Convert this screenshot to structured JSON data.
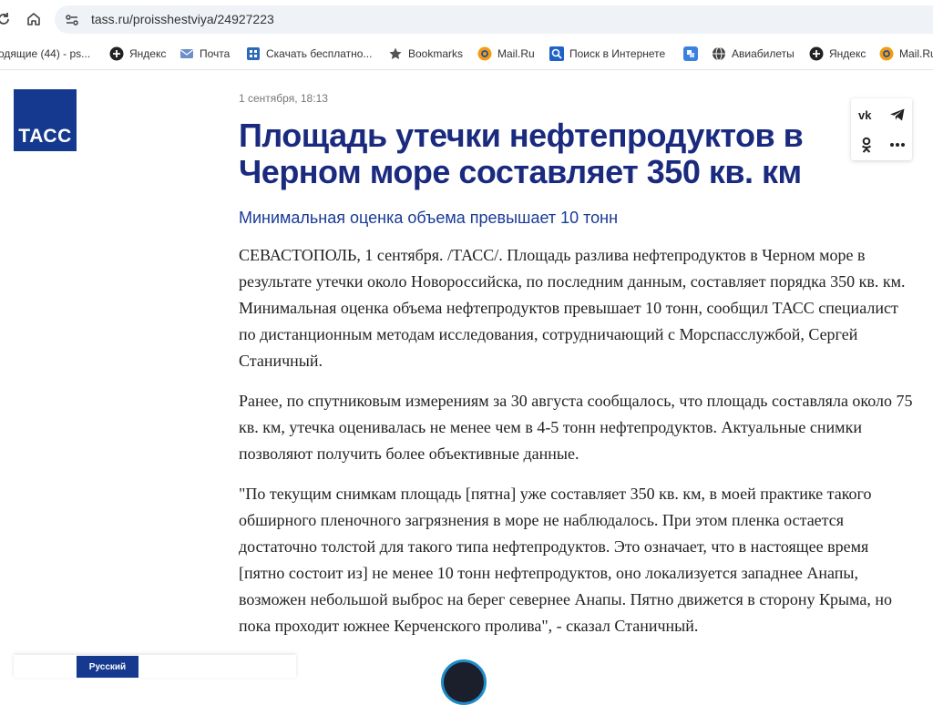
{
  "browser": {
    "url": "tass.ru/proisshestviya/24927223",
    "bookmarks": [
      {
        "label": "одящие (44) - ps...",
        "icon": "none"
      },
      {
        "label": "Яндекс",
        "icon": "yandex-icon"
      },
      {
        "label": "Почта",
        "icon": "mail-icon"
      },
      {
        "label": "Скачать бесплатно...",
        "icon": "download-app-icon"
      },
      {
        "label": "Bookmarks",
        "icon": "star-icon"
      },
      {
        "label": "Mail.Ru",
        "icon": "mailru-icon"
      },
      {
        "label": "Поиск в Интернете",
        "icon": "search-icon"
      },
      {
        "label": "",
        "icon": "app-icon"
      },
      {
        "label": "Авиабилеты",
        "icon": "globe-icon"
      },
      {
        "label": "Яндекс",
        "icon": "yandex-icon"
      },
      {
        "label": "Mail.Ru",
        "icon": "mailru-icon"
      }
    ]
  },
  "site": {
    "logo_text": "ТАСС",
    "brand_color": "#15398e",
    "headline_color": "#1a2a7f"
  },
  "article": {
    "date": "1 сентября, 18:13",
    "headline": "Площадь утечки нефтепродуктов в Черном море составляет 350 кв. км",
    "subtitle": "Минимальная оценка объема превышает 10 тонн",
    "paragraphs": [
      "СЕВАСТОПОЛЬ, 1 сентября. /ТАСС/. Площадь разлива нефтепродуктов в Черном море в результате утечки около Новороссийска, по последним данным, составляет порядка 350 кв. км. Минимальная оценка объема нефтепродуктов превышает 10 тонн, сообщил ТАСС специалист по дистанционным методам исследования, сотрудничающий с Морспасслужбой, Сергей Станичный.",
      "Ранее, по спутниковым измерениям за 30 августа сообщалось, что площадь составляла около 75 кв. км, утечка оценивалась не менее чем в 4-5 тонн нефтепродуктов. Актуальные снимки позволяют получить более объективные данные.",
      "\"По текущим снимкам площадь [пятна] уже составляет 350 кв. км, в моей практике такого обширного пленочного загрязнения в море не наблюдалось. При этом пленка остается достаточно толстой для такого типа нефтепродуктов. Это означает, что в настоящее время [пятно состоит из] не менее 10 тонн нефтепродуктов, оно локализуется западнее Анапы, возможен небольшой выброс на берег севернее Анапы. Пятно движется в сторону Крыма, но пока проходит южнее Керченского пролива\", - сказал Станичный."
    ]
  },
  "share": {
    "buttons": [
      "vk-icon",
      "telegram-icon",
      "odnoklassniki-icon",
      "more-icon"
    ]
  },
  "footer": {
    "language_label": "Русский"
  }
}
